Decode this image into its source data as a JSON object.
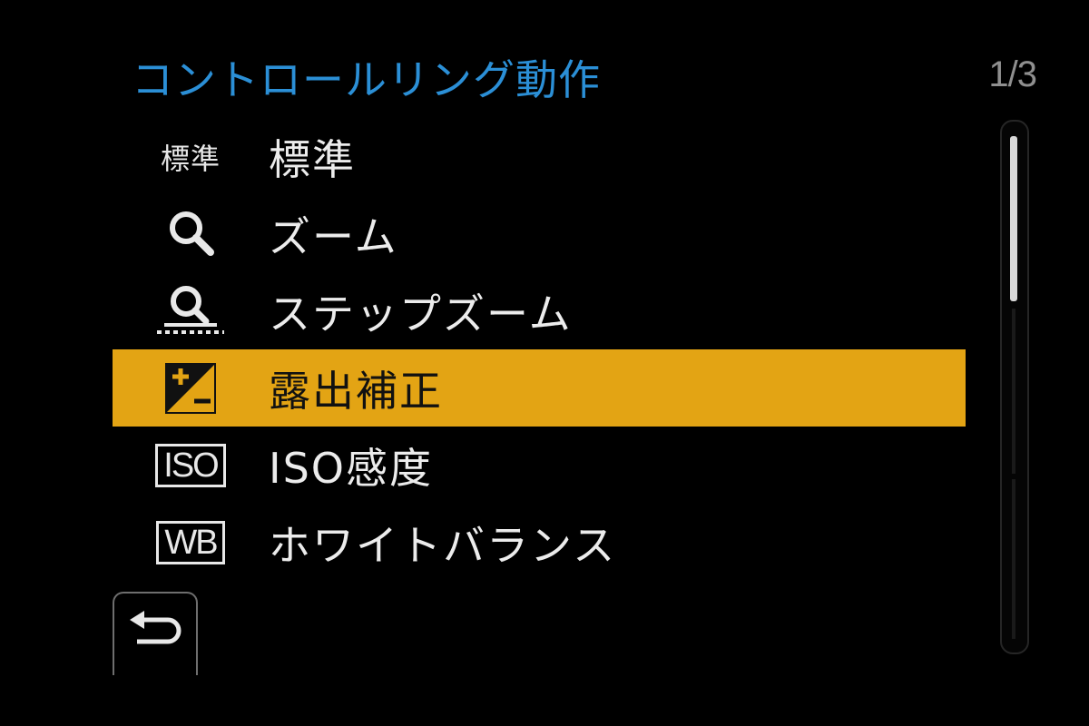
{
  "header": {
    "title": "コントロールリング動作",
    "page_indicator": "1/3"
  },
  "menu": {
    "items": [
      {
        "icon_text": "標準",
        "icon": "standard-text-icon",
        "label": "標準",
        "selected": false
      },
      {
        "icon": "zoom-magnifier-icon",
        "label": "ズーム",
        "selected": false
      },
      {
        "icon": "step-zoom-icon",
        "label": "ステップズーム",
        "selected": false
      },
      {
        "icon": "exposure-compensation-icon",
        "label": "露出補正",
        "selected": true
      },
      {
        "icon_text": "ISO",
        "icon": "iso-icon",
        "label": "ISO感度",
        "selected": false
      },
      {
        "icon_text": "WB",
        "icon": "white-balance-icon",
        "label": "ホワイトバランス",
        "selected": false
      }
    ]
  },
  "back_button": {
    "icon": "return-arrow-icon"
  },
  "colors": {
    "title": "#2b8fd6",
    "selected_background": "#e3a414",
    "text": "#ececec",
    "page_indicator": "#8f8f8f"
  },
  "scroll": {
    "page": 1,
    "pages": 3
  }
}
